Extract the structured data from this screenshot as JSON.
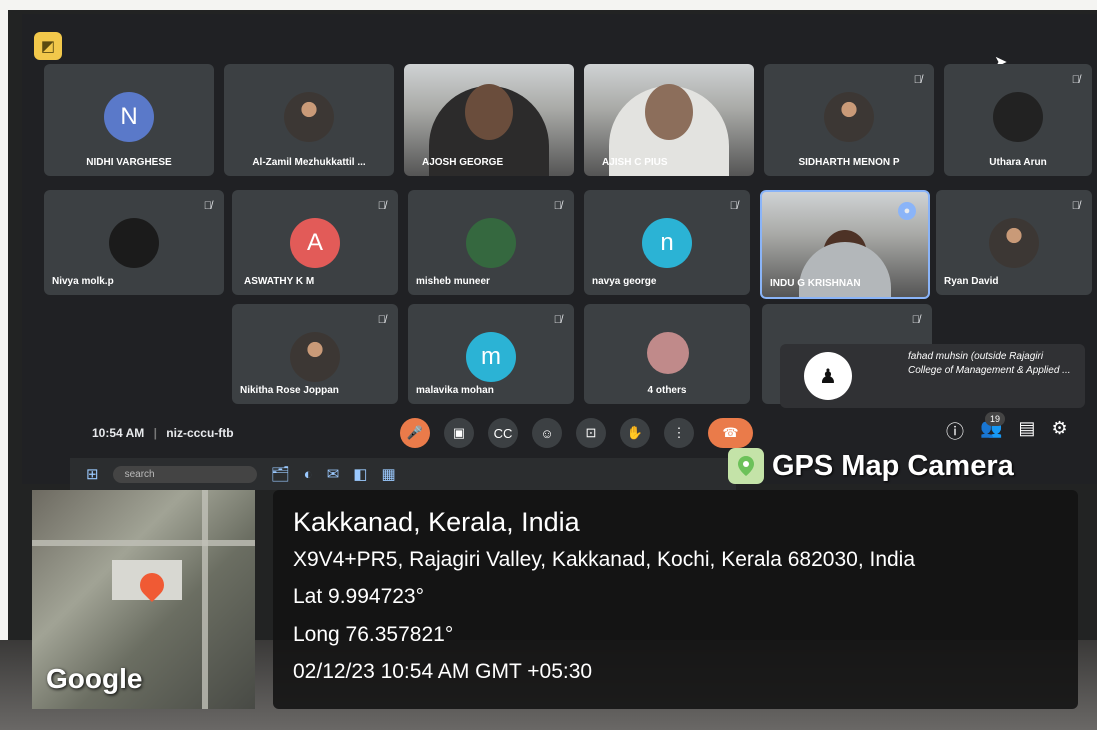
{
  "meeting": {
    "participants": [
      {
        "name": "NIDHI VARGHESE",
        "initial": "N",
        "color": "#5a79c9",
        "type": "initial"
      },
      {
        "name": "Al-Zamil Mezhukkattil ...",
        "type": "photo"
      },
      {
        "name": "AJOSH GEORGE",
        "type": "video"
      },
      {
        "name": "AJISH C PIUS",
        "type": "video"
      },
      {
        "name": "SIDHARTH MENON P",
        "type": "photo"
      },
      {
        "name": "Uthara Arun",
        "type": "photo"
      },
      {
        "name": "Nivya molk.p",
        "type": "photo"
      },
      {
        "name": "ASWATHY K M",
        "initial": "A",
        "color": "#e25b58",
        "type": "initial"
      },
      {
        "name": "misheb muneer",
        "type": "photo"
      },
      {
        "name": "navya george",
        "initial": "n",
        "color": "#2bb3d5",
        "type": "initial"
      },
      {
        "name": "INDU G KRISHNAN",
        "type": "video"
      },
      {
        "name": "Ryan David",
        "type": "photo"
      },
      {
        "name": "Nikitha Rose Joppan",
        "type": "photo"
      },
      {
        "name": "malavika mohan",
        "initial": "m",
        "color": "#2bb3d5",
        "type": "initial"
      },
      {
        "name": "4 others",
        "type": "group"
      }
    ],
    "presenter_name": "fahad muhsin (outside Rajagiri College of Management & Applied ...",
    "time": "10:54 AM",
    "meeting_code": "niz-cccu-ftb",
    "participant_count": "19",
    "taskbar_search": "search"
  },
  "gps": {
    "app_label": "GPS Map Camera",
    "place": "Kakkanad, Kerala, India",
    "address": "X9V4+PR5, Rajagiri Valley, Kakkanad, Kochi, Kerala 682030, India",
    "lat": "Lat 9.994723°",
    "long": "Long 76.357821°",
    "datetime": "02/12/23 10:54 AM GMT +05:30",
    "map_brand": "Google"
  }
}
